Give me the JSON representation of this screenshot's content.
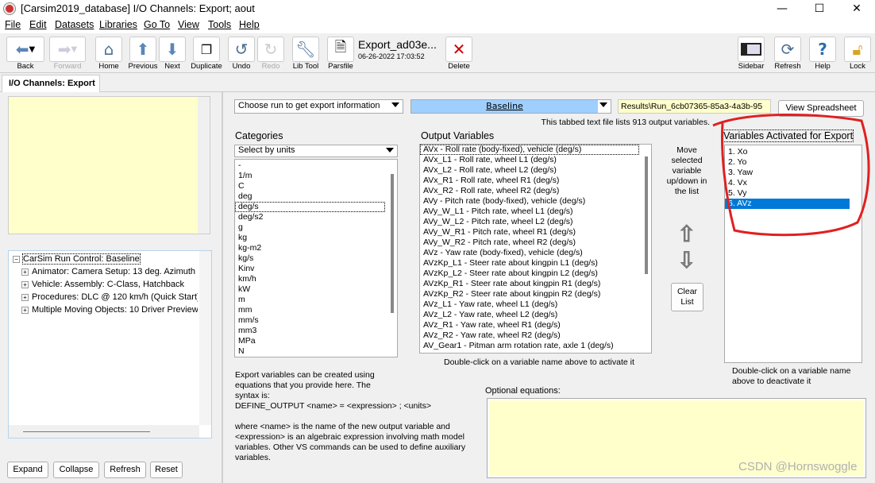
{
  "window": {
    "title": "[Carsim2019_database] I/O Channels: Export; aout",
    "controls": [
      "—",
      "☐",
      "✕"
    ]
  },
  "menu": [
    "File",
    "Edit",
    "Datasets",
    "Libraries",
    "Go To",
    "View",
    "Tools",
    "Help"
  ],
  "toolbar": {
    "back": "Back",
    "forward": "Forward",
    "home": "Home",
    "previous": "Previous",
    "next": "Next",
    "duplicate": "Duplicate",
    "undo": "Undo",
    "redo": "Redo",
    "libtool": "Lib Tool",
    "parsfile": "Parsfile",
    "dataset_title": "Export_ad03e...",
    "dataset_date": "06-26-2022 17:03:52",
    "delete": "Delete",
    "sidebar": "Sidebar",
    "refresh": "Refresh",
    "help": "Help",
    "lock": "Lock"
  },
  "tab": "I/O Channels: Export",
  "tree": {
    "root": "CarSim Run Control: Baseline",
    "children": [
      "Animator: Camera Setup: 13 deg. Azimuth",
      "Vehicle: Assembly: C-Class, Hatchback",
      "Procedures: DLC @ 120 km/h (Quick Start)",
      "Multiple Moving Objects: 10 Driver Preview"
    ]
  },
  "left_buttons": [
    "Expand",
    "Collapse",
    "Refresh",
    "Reset"
  ],
  "run": {
    "choose": "Choose run to get export information",
    "selected": "Baseline",
    "path": "Results\\Run_6cb07365-85a3-4a3b-95",
    "view_spreadsheet": "View Spreadsheet",
    "info": "This tabbed text file lists 913 output variables."
  },
  "categories": {
    "label": "Categories",
    "filter": "Select by units",
    "items": [
      "-",
      "1/m",
      "C",
      "deg",
      "deg/s",
      "deg/s2",
      "g",
      "kg",
      "kg-m2",
      "kg/s",
      "Kinv",
      "km/h",
      "kW",
      "m",
      "mm",
      "mm/s",
      "mm3",
      "MPa",
      "N"
    ],
    "focused": "deg/s"
  },
  "output": {
    "label": "Output Variables",
    "items": [
      "AVx - Roll rate (body-fixed), vehicle (deg/s)",
      "AVx_L1 - Roll rate, wheel L1 (deg/s)",
      "AVx_L2 - Roll rate, wheel L2 (deg/s)",
      "AVx_R1 - Roll rate, wheel R1 (deg/s)",
      "AVx_R2 - Roll rate, wheel R2 (deg/s)",
      "AVy - Pitch rate (body-fixed), vehicle (deg/s)",
      "AVy_W_L1 - Pitch rate, wheel L1 (deg/s)",
      "AVy_W_L2 - Pitch rate, wheel L2 (deg/s)",
      "AVy_W_R1 - Pitch rate, wheel R1 (deg/s)",
      "AVy_W_R2 - Pitch rate, wheel R2 (deg/s)",
      "AVz - Yaw rate (body-fixed), vehicle (deg/s)",
      "AVzKp_L1 - Steer rate about kingpin L1 (deg/s)",
      "AVzKp_L2 - Steer rate about kingpin L2 (deg/s)",
      "AVzKp_R1 - Steer rate about kingpin R1 (deg/s)",
      "AVzKp_R2 - Steer rate about kingpin R2 (deg/s)",
      "AVz_L1 - Yaw rate, wheel L1 (deg/s)",
      "AVz_L2 - Yaw rate, wheel L2 (deg/s)",
      "AVz_R1 - Yaw rate, wheel R1 (deg/s)",
      "AVz_R2 - Yaw rate, wheel R2 (deg/s)",
      "AV_Gear1 - Pitman arm rotation rate, axle 1 (deg/s)"
    ],
    "hint": "Double-click on a variable name above to activate it"
  },
  "move": {
    "text": "Move selected variable up/down in the list",
    "clear": "Clear List"
  },
  "activated": {
    "label": "Variables Activated for Export",
    "items": [
      "1. Xo",
      "2. Yo",
      "3. Yaw",
      "4. Vx",
      "5. Vy",
      "6. AVz"
    ],
    "selected": "6. AVz",
    "hint": "Double-click on a variable name above to deactivate it"
  },
  "equations": {
    "help1": "Export variables can be created using equations that you provide here. The syntax is:",
    "syntax": "DEFINE_OUTPUT <name> = <expression> ; <units>",
    "help2": "where <name> is the name of the new output variable and <expression> is an algebraic expression involving math model variables. Other VS commands can be used to define auxiliary variables.",
    "label": "Optional equations:",
    "value": ""
  },
  "watermark": "CSDN @Hornswoggle",
  "colors": {
    "selection": "#0078d7",
    "baseline": "#9fcfff",
    "annotation": "#e02020",
    "yellow": "#ffffcc"
  }
}
